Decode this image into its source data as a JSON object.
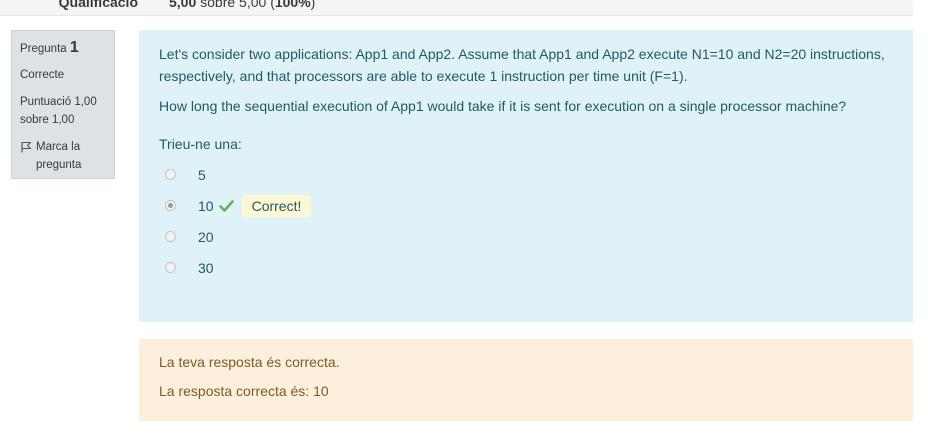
{
  "summary": {
    "label": "Qualificació",
    "value_prefix": "5,00",
    "value_middle": " sobre 5,00 (",
    "value_percent": "100%",
    "value_suffix": ")"
  },
  "info": {
    "question_label": "Pregunta",
    "question_number": "1",
    "state": "Correcte",
    "grade": "Puntuació 1,00 sobre 1,00",
    "flag_label": "Marca la pregunta"
  },
  "question": {
    "text1": "Let's consider two applications: App1 and App2. Assume that App1 and App2 execute N1=10 and N2=20 instructions, respectively, and that processors are able to execute 1 instruction per time unit (F=1).",
    "text2": "How long the sequential execution of App1 would take if it is sent for execution on a single processor machine?",
    "prompt": "Trieu-ne una:",
    "options": [
      {
        "label": "5",
        "selected": false
      },
      {
        "label": "10",
        "selected": true
      },
      {
        "label": "20",
        "selected": false
      },
      {
        "label": "30",
        "selected": false
      }
    ],
    "correct_badge": "Correct!"
  },
  "feedback": {
    "line1": "La teva resposta és correcta.",
    "line2": "La resposta correcta és: 10"
  },
  "colors": {
    "formulation_bg": "#def2f8",
    "outcome_bg": "#fcefdc",
    "info_bg": "#dee2e6",
    "check_green": "#5cb85c"
  },
  "icons": {
    "flag": "flag-icon",
    "correct": "check-icon"
  }
}
